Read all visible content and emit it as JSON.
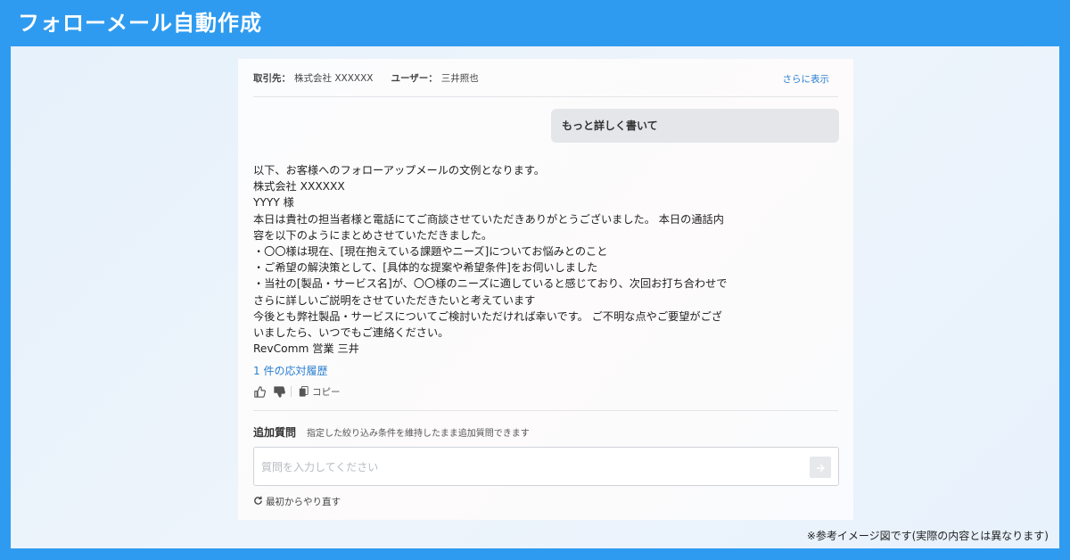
{
  "header": {
    "title": "フォローメール自動作成"
  },
  "meta": {
    "client_label": "取引先：",
    "client_value": "株式会社 XXXXXX",
    "user_label": "ユーザー：",
    "user_value": "三井照也",
    "more_link": "さらに表示"
  },
  "chat": {
    "user_message": "もっと詳しく書いて",
    "reply_lines": [
      "以下、お客様へのフォローアップメールの文例となります。",
      "株式会社 XXXXXX",
      "YYYY 様",
      "本日は貴社の担当者様と電話にてご商談させていただきありがとうございました。 本日の通話内",
      "容を以下のようにまとめさせていただきました。",
      "・〇〇様は現在、[現在抱えている課題やニーズ]についてお悩みとのこと",
      "・ご希望の解決策として、[具体的な提案や希望条件]をお伺いしました",
      "・当社の[製品・サービス名]が、〇〇様のニーズに適していると感じており、次回お打ち合わせで",
      "さらに詳しいご説明をさせていただきたいと考えています",
      "今後とも弊社製品・サービスについてご検討いただければ幸いです。 ご不明な点やご要望がござ",
      "いましたら、いつでもご連絡ください。",
      "RevComm 営業 三井"
    ],
    "history_link": "1 件の応対履歴",
    "copy_label": "コピー"
  },
  "followup": {
    "title": "追加質問",
    "description": "指定した絞り込み条件を維持したまま追加質問できます",
    "input_placeholder": "質問を入力してください",
    "input_value": "",
    "restart_label": "最初からやり直す"
  },
  "footnote": "※参考イメージ図です(実際の内容とは異なります)",
  "icons": {
    "like": "thumbs-up-icon",
    "dislike": "thumbs-down-icon",
    "copy": "copy-icon",
    "send": "send-icon",
    "restart": "refresh-icon"
  },
  "colors": {
    "brand_blue": "#2e9bf0",
    "link_blue": "#2b7fd0",
    "bubble_gray": "#e4e6ea"
  }
}
